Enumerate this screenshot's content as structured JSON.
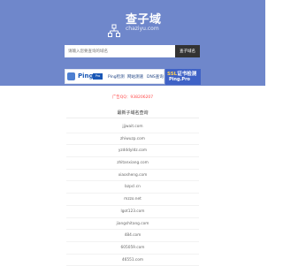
{
  "header": {
    "logo_title": "查子域",
    "logo_domain": "chaziyu.com"
  },
  "search": {
    "placeholder": "请输入您要查询的域名",
    "button_label": "查子域名"
  },
  "banner": {
    "ping_brand": "Ping",
    "ping_sub": "Pro",
    "items": [
      "Ping检测",
      "网站测速",
      "DNS查询"
    ],
    "ssl_word": "SSL",
    "ssl_rest": "证书检测",
    "ssl_sub": "Ping.Pro"
  },
  "ad": {
    "text": "广告QQ：938206207"
  },
  "recent": {
    "title": "最新子域名查询",
    "domains": [
      "jjjwait.com",
      "zhiwuzp.com",
      "yzdddyldz.com",
      "zhitanxiang.com",
      "xiaosheng.com",
      "bzpcl.cn",
      "mzzo.net",
      "lgot123.com",
      "jiangshitang.com",
      "484.com",
      "605059.com",
      "46551.com"
    ]
  },
  "colors": {
    "hero_bg": "#6f87cb",
    "search_button_bg": "#333333",
    "ad_text": "#ff4a4a",
    "ssl_banner_bg": "#3f62c6"
  }
}
